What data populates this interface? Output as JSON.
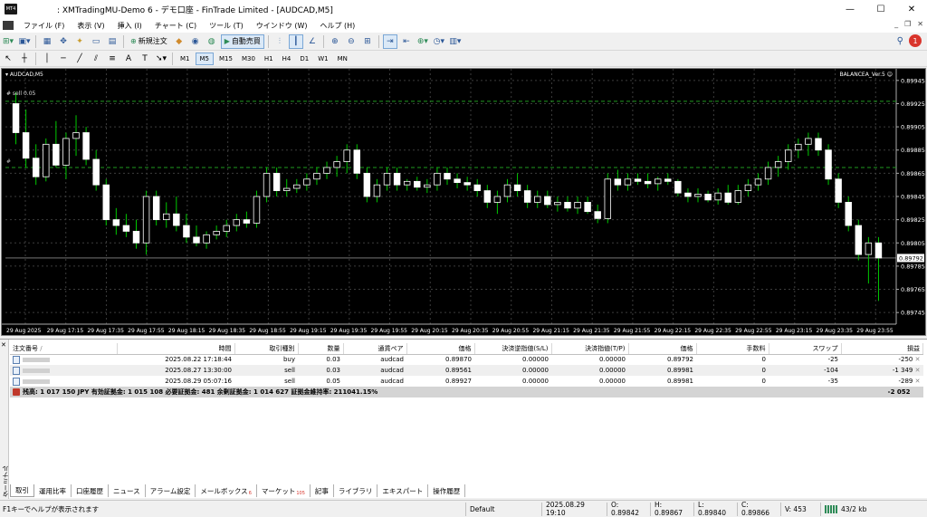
{
  "window": {
    "title": ": XMTradingMU-Demo 6 - デモ口座 - FinTrade Limited - [AUDCAD,M5]",
    "minimize": "—",
    "maximize": "☐",
    "close": "✕"
  },
  "menu": {
    "items": [
      "ファイル (F)",
      "表示 (V)",
      "挿入 (I)",
      "チャート (C)",
      "ツール (T)",
      "ウインドウ (W)",
      "ヘルプ (H)"
    ],
    "mdi": [
      "_",
      "❐",
      "✕"
    ]
  },
  "toolbar": {
    "new_order": "新規注文",
    "auto_trading": "自動売買",
    "notification_count": "1"
  },
  "timeframes": [
    "M1",
    "M5",
    "M15",
    "M30",
    "H1",
    "H4",
    "D1",
    "W1",
    "MN"
  ],
  "active_timeframe": "M5",
  "chart": {
    "symbol_label": "AUDCAD,M5",
    "ea_label": "BALANCEA_Ver.5",
    "order_label_top": "#        sell 0.05",
    "order_label_mid": "#",
    "current_price": "0.89792"
  },
  "chart_data": {
    "type": "candlestick",
    "ylim": [
      0.89735,
      0.89955
    ],
    "y_ticks": [
      "0.89945",
      "0.89925",
      "0.89905",
      "0.89885",
      "0.89865",
      "0.89845",
      "0.89825",
      "0.89805",
      "0.89785",
      "0.89765",
      "0.89745"
    ],
    "x_ticks": [
      "29 Aug 2025",
      "29 Aug 17:15",
      "29 Aug 17:35",
      "29 Aug 17:55",
      "29 Aug 18:15",
      "29 Aug 18:35",
      "29 Aug 18:55",
      "29 Aug 19:15",
      "29 Aug 19:35",
      "29 Aug 19:55",
      "29 Aug 20:15",
      "29 Aug 20:35",
      "29 Aug 20:55",
      "29 Aug 21:15",
      "29 Aug 21:35",
      "29 Aug 21:55",
      "29 Aug 22:15",
      "29 Aug 22:35",
      "29 Aug 22:55",
      "29 Aug 23:15",
      "29 Aug 23:35",
      "29 Aug 23:55"
    ],
    "levels": [
      0.89927,
      0.8987,
      0.89792
    ],
    "bg": "#000000",
    "up_color": "#ffffff",
    "down_color": "#ffffff",
    "wick_color": "#00c800",
    "candles": [
      [
        0.89925,
        0.89935,
        0.8989,
        0.899
      ],
      [
        0.899,
        0.8992,
        0.8987,
        0.89878
      ],
      [
        0.89878,
        0.8989,
        0.89855,
        0.89862
      ],
      [
        0.89862,
        0.89895,
        0.89858,
        0.8989
      ],
      [
        0.8989,
        0.8991,
        0.8987,
        0.89872
      ],
      [
        0.89872,
        0.899,
        0.8986,
        0.89895
      ],
      [
        0.89895,
        0.89915,
        0.8988,
        0.899
      ],
      [
        0.899,
        0.89905,
        0.89872,
        0.89877
      ],
      [
        0.89877,
        0.89885,
        0.8985,
        0.89855
      ],
      [
        0.89855,
        0.8986,
        0.8982,
        0.89825
      ],
      [
        0.89825,
        0.89835,
        0.89812,
        0.8982
      ],
      [
        0.8982,
        0.8983,
        0.8981,
        0.89815
      ],
      [
        0.89815,
        0.89825,
        0.898,
        0.89805
      ],
      [
        0.89805,
        0.8985,
        0.89795,
        0.89845
      ],
      [
        0.89845,
        0.8985,
        0.8982,
        0.89825
      ],
      [
        0.89825,
        0.8984,
        0.89818,
        0.8983
      ],
      [
        0.8983,
        0.89845,
        0.89815,
        0.8982
      ],
      [
        0.8982,
        0.8983,
        0.89805,
        0.8981
      ],
      [
        0.8981,
        0.8982,
        0.89802,
        0.89805
      ],
      [
        0.89805,
        0.89815,
        0.898,
        0.89812
      ],
      [
        0.89812,
        0.8982,
        0.89808,
        0.89815
      ],
      [
        0.89815,
        0.89825,
        0.8981,
        0.8982
      ],
      [
        0.8982,
        0.8983,
        0.89815,
        0.89825
      ],
      [
        0.89825,
        0.89832,
        0.89818,
        0.89822
      ],
      [
        0.89822,
        0.8985,
        0.89818,
        0.89845
      ],
      [
        0.89845,
        0.8987,
        0.8984,
        0.89865
      ],
      [
        0.89865,
        0.8987,
        0.89845,
        0.8985
      ],
      [
        0.8985,
        0.8986,
        0.89845,
        0.89852
      ],
      [
        0.89852,
        0.8986,
        0.89848,
        0.89855
      ],
      [
        0.89855,
        0.89865,
        0.8985,
        0.8986
      ],
      [
        0.8986,
        0.8987,
        0.89855,
        0.89865
      ],
      [
        0.89865,
        0.89875,
        0.8986,
        0.8987
      ],
      [
        0.8987,
        0.8988,
        0.89862,
        0.89875
      ],
      [
        0.89875,
        0.8989,
        0.89865,
        0.89885
      ],
      [
        0.89885,
        0.8989,
        0.8986,
        0.89865
      ],
      [
        0.89865,
        0.8987,
        0.8984,
        0.89845
      ],
      [
        0.89845,
        0.8986,
        0.8984,
        0.89855
      ],
      [
        0.89855,
        0.8987,
        0.8985,
        0.89865
      ],
      [
        0.89865,
        0.8987,
        0.8985,
        0.89855
      ],
      [
        0.89855,
        0.8986,
        0.8985,
        0.89858
      ],
      [
        0.89858,
        0.89862,
        0.8985,
        0.89853
      ],
      [
        0.89853,
        0.8986,
        0.89848,
        0.89855
      ],
      [
        0.89855,
        0.8987,
        0.8985,
        0.89865
      ],
      [
        0.89865,
        0.8987,
        0.89855,
        0.8986
      ],
      [
        0.8986,
        0.89865,
        0.89852,
        0.89857
      ],
      [
        0.89857,
        0.89862,
        0.8985,
        0.89855
      ],
      [
        0.89855,
        0.8986,
        0.89845,
        0.8985
      ],
      [
        0.8985,
        0.89855,
        0.89835,
        0.8984
      ],
      [
        0.8984,
        0.8985,
        0.8983,
        0.89845
      ],
      [
        0.89845,
        0.8986,
        0.8984,
        0.89855
      ],
      [
        0.89855,
        0.89865,
        0.89845,
        0.8985
      ],
      [
        0.8985,
        0.89855,
        0.89835,
        0.8984
      ],
      [
        0.8984,
        0.8985,
        0.89835,
        0.89845
      ],
      [
        0.89845,
        0.8985,
        0.89835,
        0.89838
      ],
      [
        0.89838,
        0.89845,
        0.89832,
        0.8984
      ],
      [
        0.8984,
        0.89845,
        0.89832,
        0.89835
      ],
      [
        0.89835,
        0.89845,
        0.8983,
        0.8984
      ],
      [
        0.8984,
        0.89845,
        0.8983,
        0.89832
      ],
      [
        0.89832,
        0.89838,
        0.89822,
        0.89826
      ],
      [
        0.89826,
        0.89865,
        0.89822,
        0.8986
      ],
      [
        0.8986,
        0.89868,
        0.8985,
        0.89855
      ],
      [
        0.89855,
        0.89865,
        0.8985,
        0.8986
      ],
      [
        0.8986,
        0.89865,
        0.89855,
        0.89858
      ],
      [
        0.89858,
        0.89865,
        0.89852,
        0.89856
      ],
      [
        0.89856,
        0.89862,
        0.8985,
        0.8986
      ],
      [
        0.8986,
        0.89865,
        0.89855,
        0.89858
      ],
      [
        0.89858,
        0.8986,
        0.89845,
        0.89848
      ],
      [
        0.89848,
        0.89852,
        0.8984,
        0.89845
      ],
      [
        0.89845,
        0.89852,
        0.8984,
        0.89847
      ],
      [
        0.89847,
        0.8985,
        0.8984,
        0.89842
      ],
      [
        0.89842,
        0.89852,
        0.89838,
        0.89848
      ],
      [
        0.89848,
        0.89855,
        0.89838,
        0.8984
      ],
      [
        0.8984,
        0.89855,
        0.89838,
        0.8985
      ],
      [
        0.8985,
        0.8986,
        0.89845,
        0.89855
      ],
      [
        0.89855,
        0.89865,
        0.8985,
        0.8986
      ],
      [
        0.8986,
        0.89875,
        0.89855,
        0.8987
      ],
      [
        0.8987,
        0.8988,
        0.89862,
        0.89875
      ],
      [
        0.89875,
        0.8989,
        0.89868,
        0.89885
      ],
      [
        0.89885,
        0.89895,
        0.89878,
        0.8989
      ],
      [
        0.8989,
        0.899,
        0.8988,
        0.89895
      ],
      [
        0.89895,
        0.899,
        0.8988,
        0.89885
      ],
      [
        0.89885,
        0.8989,
        0.89855,
        0.8986
      ],
      [
        0.8986,
        0.89865,
        0.89835,
        0.8984
      ],
      [
        0.8984,
        0.89845,
        0.89815,
        0.8982
      ],
      [
        0.8982,
        0.89825,
        0.8979,
        0.89795
      ],
      [
        0.89795,
        0.8981,
        0.8977,
        0.89805
      ],
      [
        0.89805,
        0.8981,
        0.89755,
        0.89792
      ]
    ]
  },
  "terminal": {
    "columns": [
      "注文番号",
      "/",
      "時間",
      "取引種別",
      "数量",
      "通貨ペア",
      "価格",
      "決済逆指値(S/L)",
      "決済指値(T/P)",
      "価格",
      "手数料",
      "スワップ",
      "損益"
    ],
    "rows": [
      [
        "",
        "2025.08.22 17:18:44",
        "buy",
        "0.03",
        "audcad",
        "0.89870",
        "0.00000",
        "0.00000",
        "0.89792",
        "0",
        "-25",
        "-250"
      ],
      [
        "",
        "2025.08.27 13:30:00",
        "sell",
        "0.03",
        "audcad",
        "0.89561",
        "0.00000",
        "0.00000",
        "0.89981",
        "0",
        "-104",
        "-1 349"
      ],
      [
        "",
        "2025.08.29 05:07:16",
        "sell",
        "0.05",
        "audcad",
        "0.89927",
        "0.00000",
        "0.00000",
        "0.89981",
        "0",
        "-35",
        "-289"
      ]
    ],
    "summary": "残高: 1 017 150 JPY  有効証拠金: 1 015 108  必要証拠金: 481  余剰証拠金: 1 014 627  証拠金維持率: 211041.15%",
    "summary_total": "-2 052",
    "side_label": "ターミナル",
    "close_symbol": "✕"
  },
  "tabs": [
    {
      "label": "取引"
    },
    {
      "label": "運用比率"
    },
    {
      "label": "口座履歴"
    },
    {
      "label": "ニュース"
    },
    {
      "label": "アラーム設定"
    },
    {
      "label": "メールボックス",
      "badge": "6"
    },
    {
      "label": "マーケット",
      "badge": "105"
    },
    {
      "label": "記事"
    },
    {
      "label": "ライブラリ"
    },
    {
      "label": "エキスパート"
    },
    {
      "label": "操作履歴"
    }
  ],
  "status": {
    "help": "F1キーでヘルプが表示されます",
    "profile": "Default",
    "datetime": "2025.08.29 19:10",
    "open": "O: 0.89842",
    "high": "H: 0.89867",
    "low": "L: 0.89840",
    "close": "C: 0.89866",
    "volume": "V: 453",
    "traffic": "43/2 kb"
  }
}
